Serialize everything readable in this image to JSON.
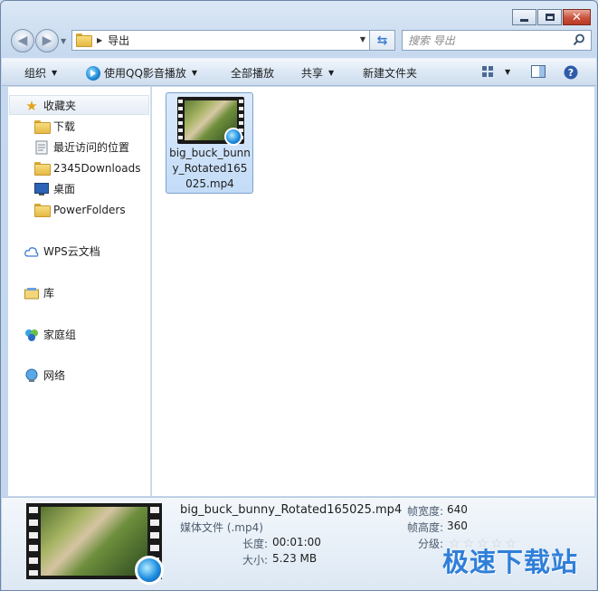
{
  "address": {
    "crumbs": [
      "导出"
    ]
  },
  "search": {
    "placeholder": "搜索 导出"
  },
  "toolbar": {
    "organize": "组织",
    "play_qq": "使用QQ影音播放",
    "play_all": "全部播放",
    "share": "共享",
    "new_folder": "新建文件夹"
  },
  "sidebar": {
    "favorites": "收藏夹",
    "fav_items": [
      "下载",
      "最近访问的位置",
      "2345Downloads",
      "桌面",
      "PowerFolders"
    ],
    "wps": "WPS云文档",
    "library": "库",
    "homegroup": "家庭组",
    "network": "网络"
  },
  "file": {
    "name": "big_buck_bunny_Rotated165025.mp4"
  },
  "details": {
    "name": "big_buck_bunny_Rotated165025.mp4",
    "type": "媒体文件 (.mp4)",
    "length_label": "长度:",
    "length": "00:01:00",
    "size_label": "大小:",
    "size": "5.23 MB",
    "width_label": "帧宽度:",
    "width": "640",
    "height_label": "帧高度:",
    "height": "360",
    "rating_label": "分级:",
    "rating": 0,
    "rating_max": 5
  },
  "watermark": "极速下载站",
  "colors": {
    "accent": "#2f7fd8",
    "selection": "#cde1f8"
  }
}
